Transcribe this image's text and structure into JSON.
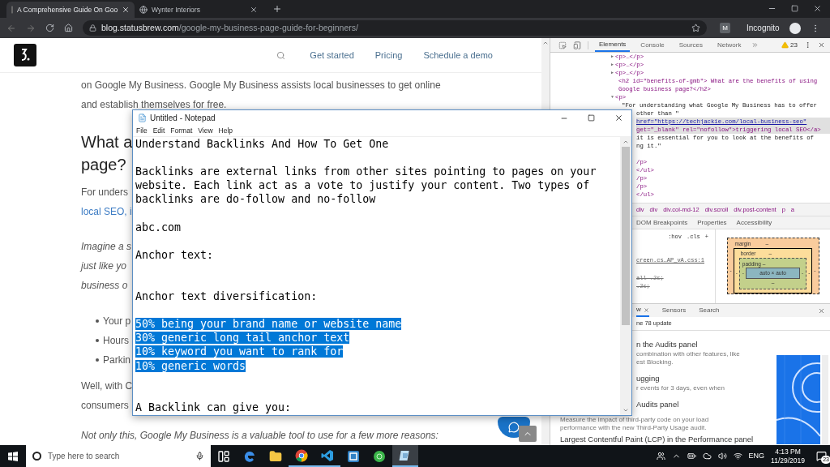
{
  "browser": {
    "tabs": [
      {
        "title": "A Comprehensive Guide On Goo",
        "selected": true
      },
      {
        "title": "Wynter Interiors",
        "selected": false
      }
    ],
    "address": {
      "host": "blog.statusbrew.com",
      "path": "/google-my-business-page-guide-for-beginners/"
    },
    "extension_badge": "M",
    "profile_label": "Incognito"
  },
  "page": {
    "nav": [
      "Get started",
      "Pricing",
      "Schedule a demo"
    ],
    "content": [
      {
        "kind": "paragraph",
        "lines": [
          "on Google My Business. Google My Business assists local businesses to get online",
          "and establish themselves for free."
        ]
      },
      {
        "kind": "heading",
        "lines": [
          "What a",
          "page?"
        ]
      },
      {
        "kind": "paragraph",
        "lines": [
          "For unders"
        ],
        "link": "local SEO, i"
      },
      {
        "kind": "italic",
        "lines": [
          "Imagine a s",
          "just like yo",
          "business o"
        ]
      },
      {
        "kind": "bullets",
        "lines": [
          "Your p",
          "Hours",
          "Parkin"
        ]
      },
      {
        "kind": "paragraph",
        "lines": [
          "Well, with C",
          "consumers"
        ]
      },
      {
        "kind": "italic",
        "lines": [
          "Not only this, Google My Business is a valuable tool to use for a few more reasons:"
        ]
      }
    ]
  },
  "notepad": {
    "title": "Untitled - Notepad",
    "menu": [
      "File",
      "Edit",
      "Format",
      "View",
      "Help"
    ],
    "text_before": "Understand Backlinks And How To Get One\n\nBacklinks are external links from other sites pointing to pages on your\nwebsite. Each link act as a vote to justify your content. Two types of\nbacklinks are do-follow and no-follow\n\nabc.com\n\nAnchor text:\n\n\nAnchor text diversification:\n\n",
    "selection": "50% being your brand name or website name\n30% generic long tail anchor text\n10% keyword you want to rank for\n10% generic words",
    "text_after": "\n\n\nA Backlink can give you:"
  },
  "devtools": {
    "tabs": [
      {
        "label": "Elements",
        "selected": true
      },
      {
        "label": "Console",
        "selected": false
      },
      {
        "label": "Sources",
        "selected": false
      },
      {
        "label": "Network",
        "selected": false
      }
    ],
    "warnings": "23",
    "dom": [
      {
        "text": "<p>…</p>",
        "kind": "tag",
        "marker": "▶",
        "selected": false
      },
      {
        "text": "<p>…</p>",
        "kind": "tag",
        "marker": "▶",
        "selected": false
      },
      {
        "text": "<p>…</p>",
        "kind": "tag",
        "marker": "▶",
        "selected": false
      },
      {
        "text": "<h2 id=\"benefits-of-gmb\"> What are the benefits of using",
        "kind": "tag",
        "selected": false
      },
      {
        "text": "Google business page?</h2>",
        "kind": "tag",
        "selected": false
      },
      {
        "text": "<p>",
        "kind": "tag",
        "marker": "▼",
        "selected": false
      },
      {
        "text": "\"For understanding what Google My Business has to offer",
        "kind": "text",
        "selected": false
      },
      {
        "text": "other than \"",
        "kind": "text",
        "selected": false
      },
      {
        "text": "href=\"https://techjackie.com/local-business-seo\"",
        "kind": "link",
        "selected": true
      },
      {
        "text": "get=\"_blank\" rel=\"nofollow\">triggering local SEO</a>",
        "kind": "tag",
        "selected": true
      },
      {
        "text": "it is essential for you to look at the benefits of",
        "kind": "text",
        "selected": false
      },
      {
        "text": "ng it.\"",
        "kind": "text",
        "selected": false
      },
      {
        "text": "/p>",
        "kind": "tag",
        "selected": false
      },
      {
        "text": "</ul>",
        "kind": "tag",
        "selected": false
      },
      {
        "text": "/p>",
        "kind": "tag",
        "selected": false
      },
      {
        "text": "/p>",
        "kind": "tag",
        "selected": false
      },
      {
        "text": "</ul>",
        "kind": "tag",
        "selected": false
      }
    ],
    "breadcrumb": [
      "div",
      "div",
      "div.col-md-12",
      "div.scroll",
      "div.post-content",
      "p",
      "a"
    ],
    "sidebar_tabs": [
      "DOM Breakpoints",
      "Properties",
      "Accessibility"
    ],
    "style_buttons": [
      ":hov",
      ".cls",
      "+"
    ],
    "style_source": "creen.cs…AP_vA.css:1",
    "style_rules": [
      "all .2s;",
      ".2s;"
    ],
    "box_model": {
      "margin_label": "margin",
      "margin_top": "–",
      "border_label": "border",
      "border_top": "–",
      "padding_label": "padding –",
      "content": "auto × auto",
      "padding_bottom": "–",
      "left": [
        "-",
        "-",
        "-"
      ],
      "right": [
        "-",
        "-",
        "-"
      ]
    },
    "drawer": {
      "tabs": [
        {
          "label": "w",
          "selected": true
        },
        {
          "label": "Sensors",
          "selected": false
        },
        {
          "label": "Search",
          "selected": false
        }
      ],
      "notice": "ne 78 update",
      "items": [
        {
          "title": "n the Audits panel",
          "lines": [
            "combination with other features, like",
            "est Blocking."
          ]
        },
        {
          "title": "ugging",
          "lines": [
            "r events for 3 days, even when"
          ]
        },
        {
          "title": "Audits panel",
          "lines": [
            "Measure the impact of third-party code on your load",
            "performance with the new Third-Party Usage audit."
          ]
        },
        {
          "title": "Largest Contentful Paint (LCP) in the Performance panel"
        }
      ]
    }
  },
  "taskbar": {
    "search_placeholder": "Type here to search",
    "apps": [
      {
        "kind": "taskview",
        "running": false,
        "selected": false
      },
      {
        "kind": "edge",
        "running": false,
        "selected": false
      },
      {
        "kind": "folder",
        "running": false,
        "selected": false
      },
      {
        "kind": "chrome",
        "running": true,
        "selected": false
      },
      {
        "kind": "vscode",
        "running": true,
        "selected": false
      },
      {
        "kind": "app",
        "running": false,
        "selected": false
      },
      {
        "kind": "globe",
        "running": false,
        "selected": false
      },
      {
        "kind": "notepad",
        "running": true,
        "selected": true
      }
    ],
    "language": "ENG",
    "time": "4:13 PM",
    "date": "11/29/2019",
    "notifications": "23"
  }
}
